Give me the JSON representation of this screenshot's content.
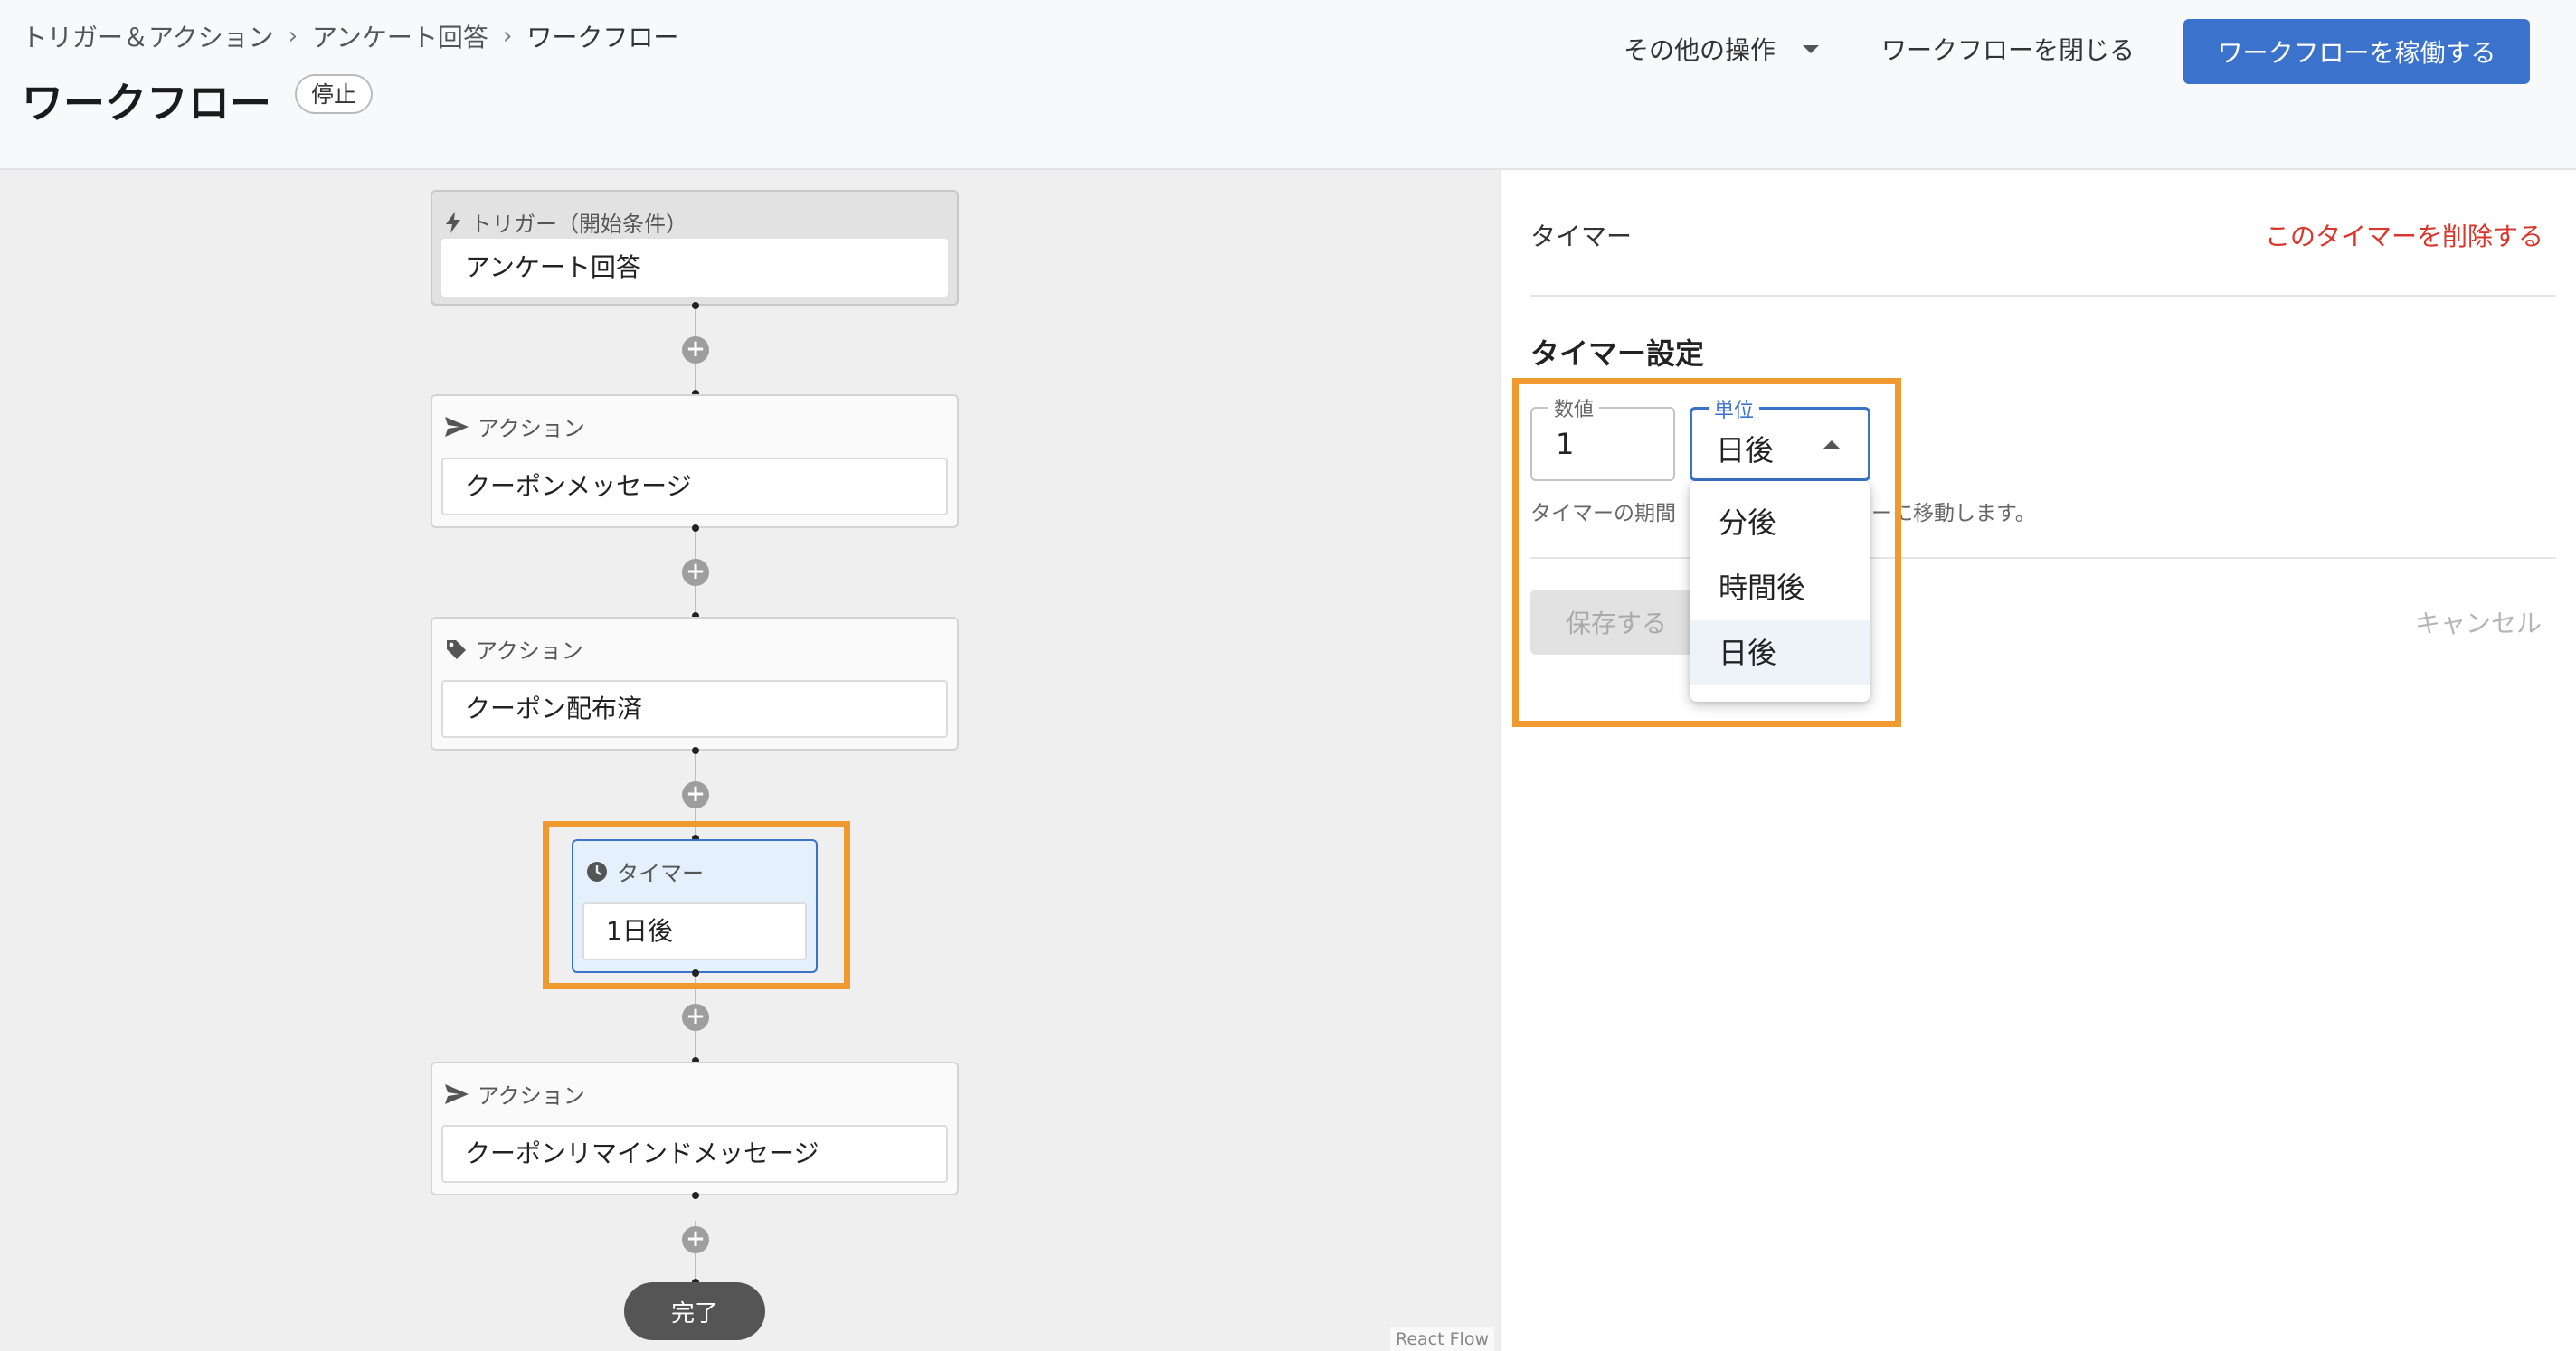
{
  "header": {
    "breadcrumb": [
      "トリガー＆アクション",
      "アンケート回答",
      "ワークフロー"
    ],
    "breadcrumb_separator": "›",
    "title": "ワークフロー",
    "status": "停止",
    "more_actions": "その他の操作",
    "close_workflow": "ワークフローを閉じる",
    "activate_workflow": "ワークフローを稼働する"
  },
  "flow": {
    "trigger": {
      "type_label": "トリガー（開始条件）",
      "name": "アンケート回答",
      "icon": "lightning-icon"
    },
    "steps": [
      {
        "type_label": "アクション",
        "name": "クーポンメッセージ",
        "icon": "send-icon"
      },
      {
        "type_label": "アクション",
        "name": "クーポン配布済",
        "icon": "tag-icon"
      },
      {
        "type_label": "タイマー",
        "name": "1日後",
        "icon": "clock-icon"
      },
      {
        "type_label": "アクション",
        "name": "クーポンリマインドメッセージ",
        "icon": "send-icon"
      }
    ],
    "add_symbol": "+",
    "end_label": "完了",
    "attribution": "React Flow"
  },
  "panel": {
    "title": "タイマー",
    "delete_label": "このタイマーを削除する",
    "section_title": "タイマー設定",
    "number_field": {
      "label": "数値",
      "value": "1"
    },
    "unit_field": {
      "label": "単位",
      "value": "日後"
    },
    "helper_text_left": "タイマーの期間",
    "helper_text_right": "フローに移動します。",
    "unit_options": [
      "分後",
      "時間後",
      "日後"
    ],
    "selected_option_index": 2,
    "save_label": "保存する",
    "cancel_label": "キャンセル"
  },
  "colors": {
    "primary": "#3b73cc",
    "danger": "#d9372c",
    "highlight": "#f0992e"
  }
}
